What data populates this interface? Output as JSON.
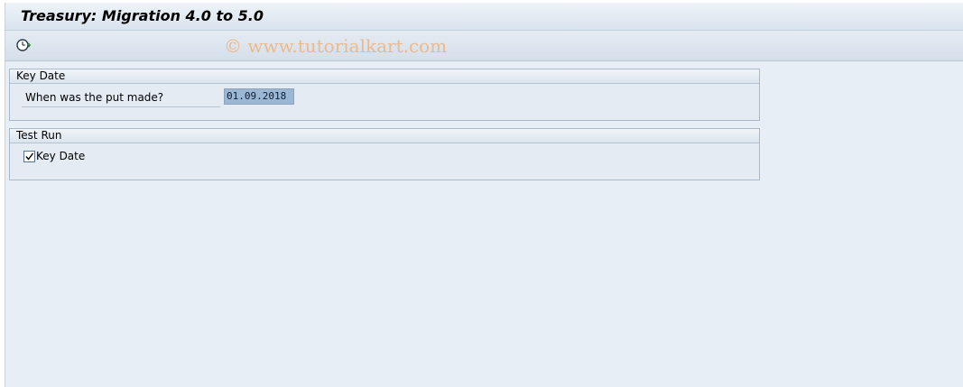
{
  "window": {
    "title": "Treasury: Migration 4.0 to 5.0"
  },
  "toolbar": {
    "execute_icon": "execute-clock-icon",
    "watermark": "© www.tutorialkart.com"
  },
  "key_date_group": {
    "header": "Key Date",
    "put_made_label": "When was the put made?",
    "put_made_value": "01.09.2018"
  },
  "test_run_group": {
    "header": "Test Run",
    "key_date_checkbox_label": "Key Date",
    "key_date_checked": true
  },
  "colors": {
    "background": "#e8eef5",
    "selected_input": "#9bb7d4",
    "watermark": "#f0b27a"
  }
}
